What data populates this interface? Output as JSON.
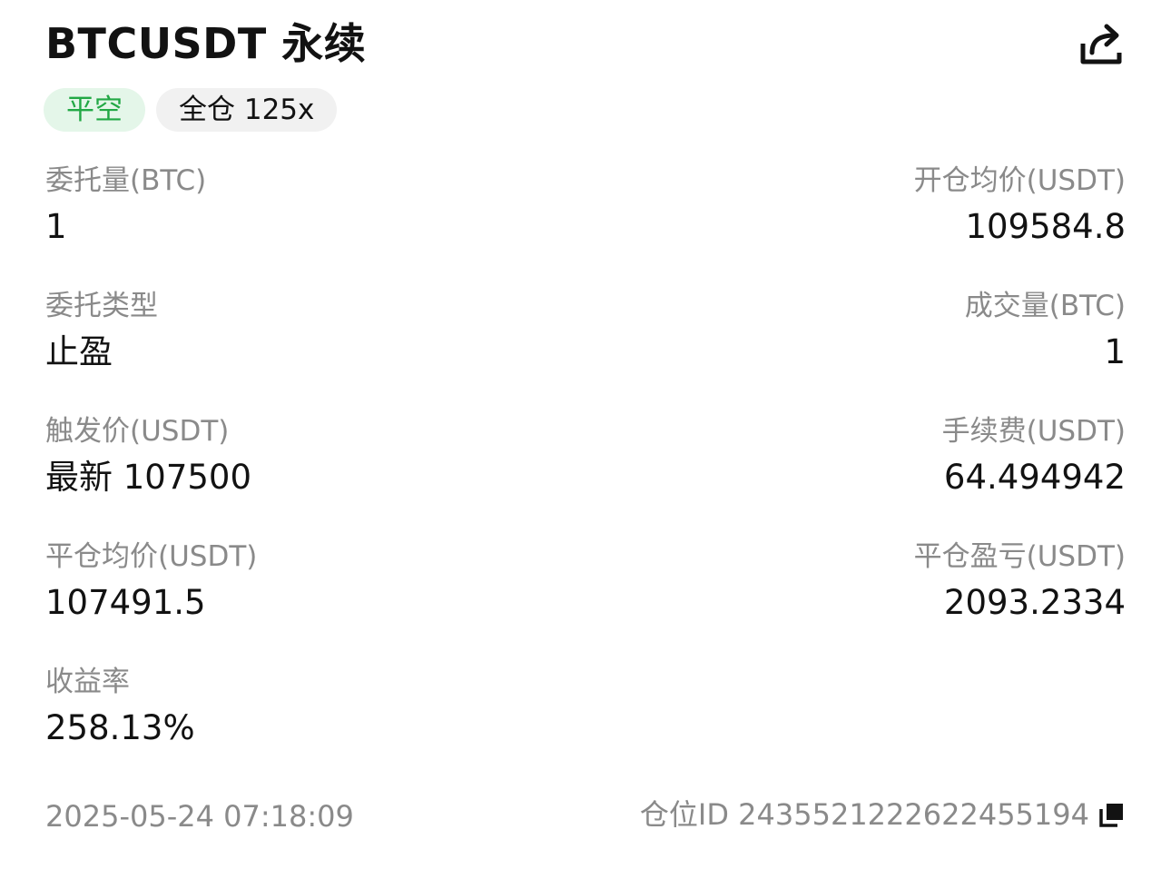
{
  "header": {
    "title": "BTCUSDT 永续",
    "share_icon": "share-icon"
  },
  "tags": {
    "side": "平空",
    "margin": "全仓 125x"
  },
  "fields": {
    "order_qty": {
      "label": "委托量(BTC)",
      "value": "1"
    },
    "open_avg_price": {
      "label": "开仓均价(USDT)",
      "value": "109584.8"
    },
    "order_type": {
      "label": "委托类型",
      "value": "止盈"
    },
    "filled_qty": {
      "label": "成交量(BTC)",
      "value": "1"
    },
    "trigger_price": {
      "label": "触发价(USDT)",
      "value": "最新 107500"
    },
    "fee": {
      "label": "手续费(USDT)",
      "value": "64.494942"
    },
    "close_avg_price": {
      "label": "平仓均价(USDT)",
      "value": "107491.5"
    },
    "close_pnl": {
      "label": "平仓盈亏(USDT)",
      "value": "2093.2334"
    },
    "roi": {
      "label": "收益率",
      "value": "258.13%"
    }
  },
  "footer": {
    "time": "2025-05-24 07:18:09",
    "position_id": "仓位ID 2435521222622455194",
    "copy_icon": "copy-icon"
  },
  "colors": {
    "green": "#22a845",
    "green_bg": "#e4f6e9",
    "gray_bg": "#f1f1f1",
    "label_gray": "#8a8a8a",
    "text": "#121212"
  }
}
